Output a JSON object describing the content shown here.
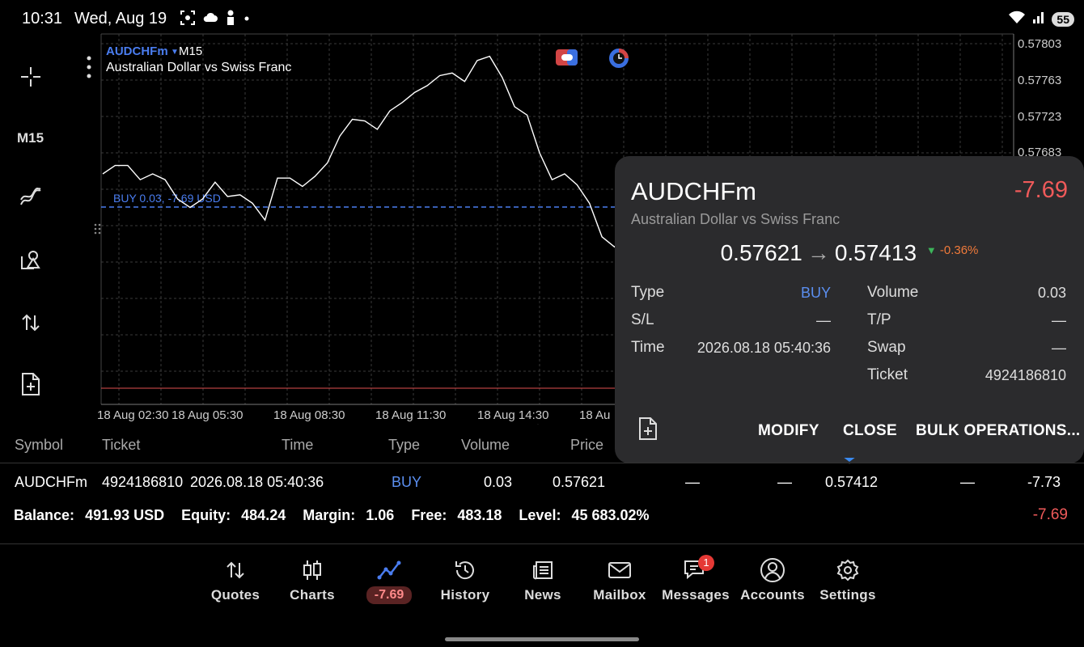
{
  "status_bar": {
    "time": "10:31",
    "date": "Wed, Aug 19",
    "battery": "55"
  },
  "toolbar": {
    "timeframe": "M15"
  },
  "chart": {
    "symbol": "AUDCHFm",
    "timeframe": "M15",
    "description": "Australian Dollar vs Swiss Franc",
    "trade_line_label": "BUY 0.03, -7.69 USD",
    "price_labels": [
      "0.57803",
      "0.57763",
      "0.57723",
      "0.57683"
    ],
    "time_labels": [
      "18 Aug 02:30",
      "18 Aug 05:30",
      "18 Aug 08:30",
      "18 Aug 11:30",
      "18 Aug 14:30",
      "18 Au"
    ],
    "colors": {
      "line": "#ffffff",
      "trade_line": "#4a7df0",
      "grid": "#3a3a3a",
      "stop_line": "#e05050"
    }
  },
  "chart_data": {
    "type": "line",
    "title": "AUDCHFm M15",
    "ylim": [
      0.5755,
      0.5781
    ],
    "x": [
      0,
      1,
      2,
      3,
      4,
      5,
      6,
      7,
      8,
      9,
      10,
      11,
      12,
      13,
      14,
      15,
      16,
      17,
      18,
      19,
      20,
      21,
      22,
      23,
      24,
      25,
      26,
      27,
      28,
      29,
      30,
      31,
      32,
      33,
      34,
      35,
      36,
      37,
      38,
      39,
      40,
      41,
      42
    ],
    "series": [
      {
        "values": [
          0.57655,
          0.57665,
          0.57665,
          0.57648,
          0.57655,
          0.57648,
          0.57625,
          0.57615,
          0.57625,
          0.57645,
          0.57628,
          0.5763,
          0.5762,
          0.576,
          0.5765,
          0.5765,
          0.5764,
          0.57652,
          0.57668,
          0.577,
          0.5772,
          0.57718,
          0.57708,
          0.5773,
          0.5774,
          0.57752,
          0.5776,
          0.57772,
          0.57775,
          0.57765,
          0.5779,
          0.57795,
          0.5777,
          0.57735,
          0.57725,
          0.5768,
          0.57648,
          0.57655,
          0.57642,
          0.5762,
          0.5758,
          0.57568,
          0.5758
        ]
      }
    ]
  },
  "card": {
    "symbol": "AUDCHFm",
    "profit": "-7.69",
    "description": "Australian Dollar vs Swiss Franc",
    "open_price": "0.57621",
    "current_price": "0.57413",
    "change": "-0.36%",
    "fields_left": [
      {
        "label": "Type",
        "value": "BUY"
      },
      {
        "label": "S/L",
        "value": "—"
      },
      {
        "label": "Time",
        "value": "2026.08.18 05:40:36"
      }
    ],
    "fields_right": [
      {
        "label": "Volume",
        "value": "0.03"
      },
      {
        "label": "T/P",
        "value": "—"
      },
      {
        "label": "Swap",
        "value": "—"
      },
      {
        "label": "Ticket",
        "value": "4924186810"
      }
    ],
    "buttons": {
      "modify": "MODIFY",
      "close": "CLOSE",
      "bulk": "BULK OPERATIONS..."
    }
  },
  "positions_table": {
    "headers": [
      "Symbol",
      "Ticket",
      "Time",
      "Type",
      "Volume",
      "Price"
    ],
    "row": {
      "symbol": "AUDCHFm",
      "ticket": "4924186810",
      "time": "2026.08.18 05:40:36",
      "type": "BUY",
      "volume": "0.03",
      "price": "0.57621",
      "sl": "—",
      "tp": "—",
      "current": "0.57412",
      "swap": "—",
      "profit": "-7.73"
    }
  },
  "summary": {
    "balance_label": "Balance:",
    "balance": "491.93 USD",
    "equity_label": "Equity:",
    "equity": "484.24",
    "margin_label": "Margin:",
    "margin": "1.06",
    "free_label": "Free:",
    "free": "483.18",
    "level_label": "Level:",
    "level": "45 683.02%",
    "total_profit": "-7.69"
  },
  "nav": [
    {
      "label": "Quotes"
    },
    {
      "label": "Charts"
    },
    {
      "label": "-7.69"
    },
    {
      "label": "History"
    },
    {
      "label": "News"
    },
    {
      "label": "Mailbox"
    },
    {
      "label": "Messages",
      "badge": "1"
    },
    {
      "label": "Accounts"
    },
    {
      "label": "Settings"
    }
  ]
}
